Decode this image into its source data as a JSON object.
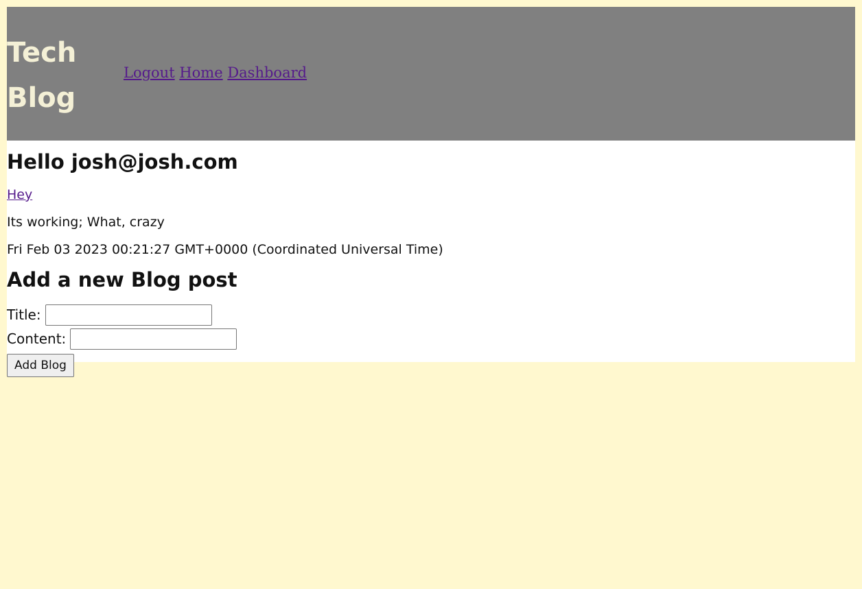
{
  "header": {
    "title_line1": "Tech",
    "title_line2": "Blog",
    "nav": {
      "logout": "Logout",
      "home": "Home",
      "dashboard": "Dashboard"
    }
  },
  "main": {
    "greeting": "Hello josh@josh.com",
    "post": {
      "title": "Hey",
      "content": "Its working; What, crazy",
      "date": "Fri Feb 03 2023 00:21:27 GMT+0000 (Coordinated Universal Time)"
    },
    "form": {
      "heading": "Add a new Blog post",
      "title_label": "Title:",
      "title_value": "",
      "content_label": "Content:",
      "content_value": "",
      "submit_label": "Add Blog"
    }
  },
  "colors": {
    "page_background": "#fff8cf",
    "header_background": "#808080",
    "title_color": "#f4f0d6",
    "link_color": "#551a8b"
  }
}
